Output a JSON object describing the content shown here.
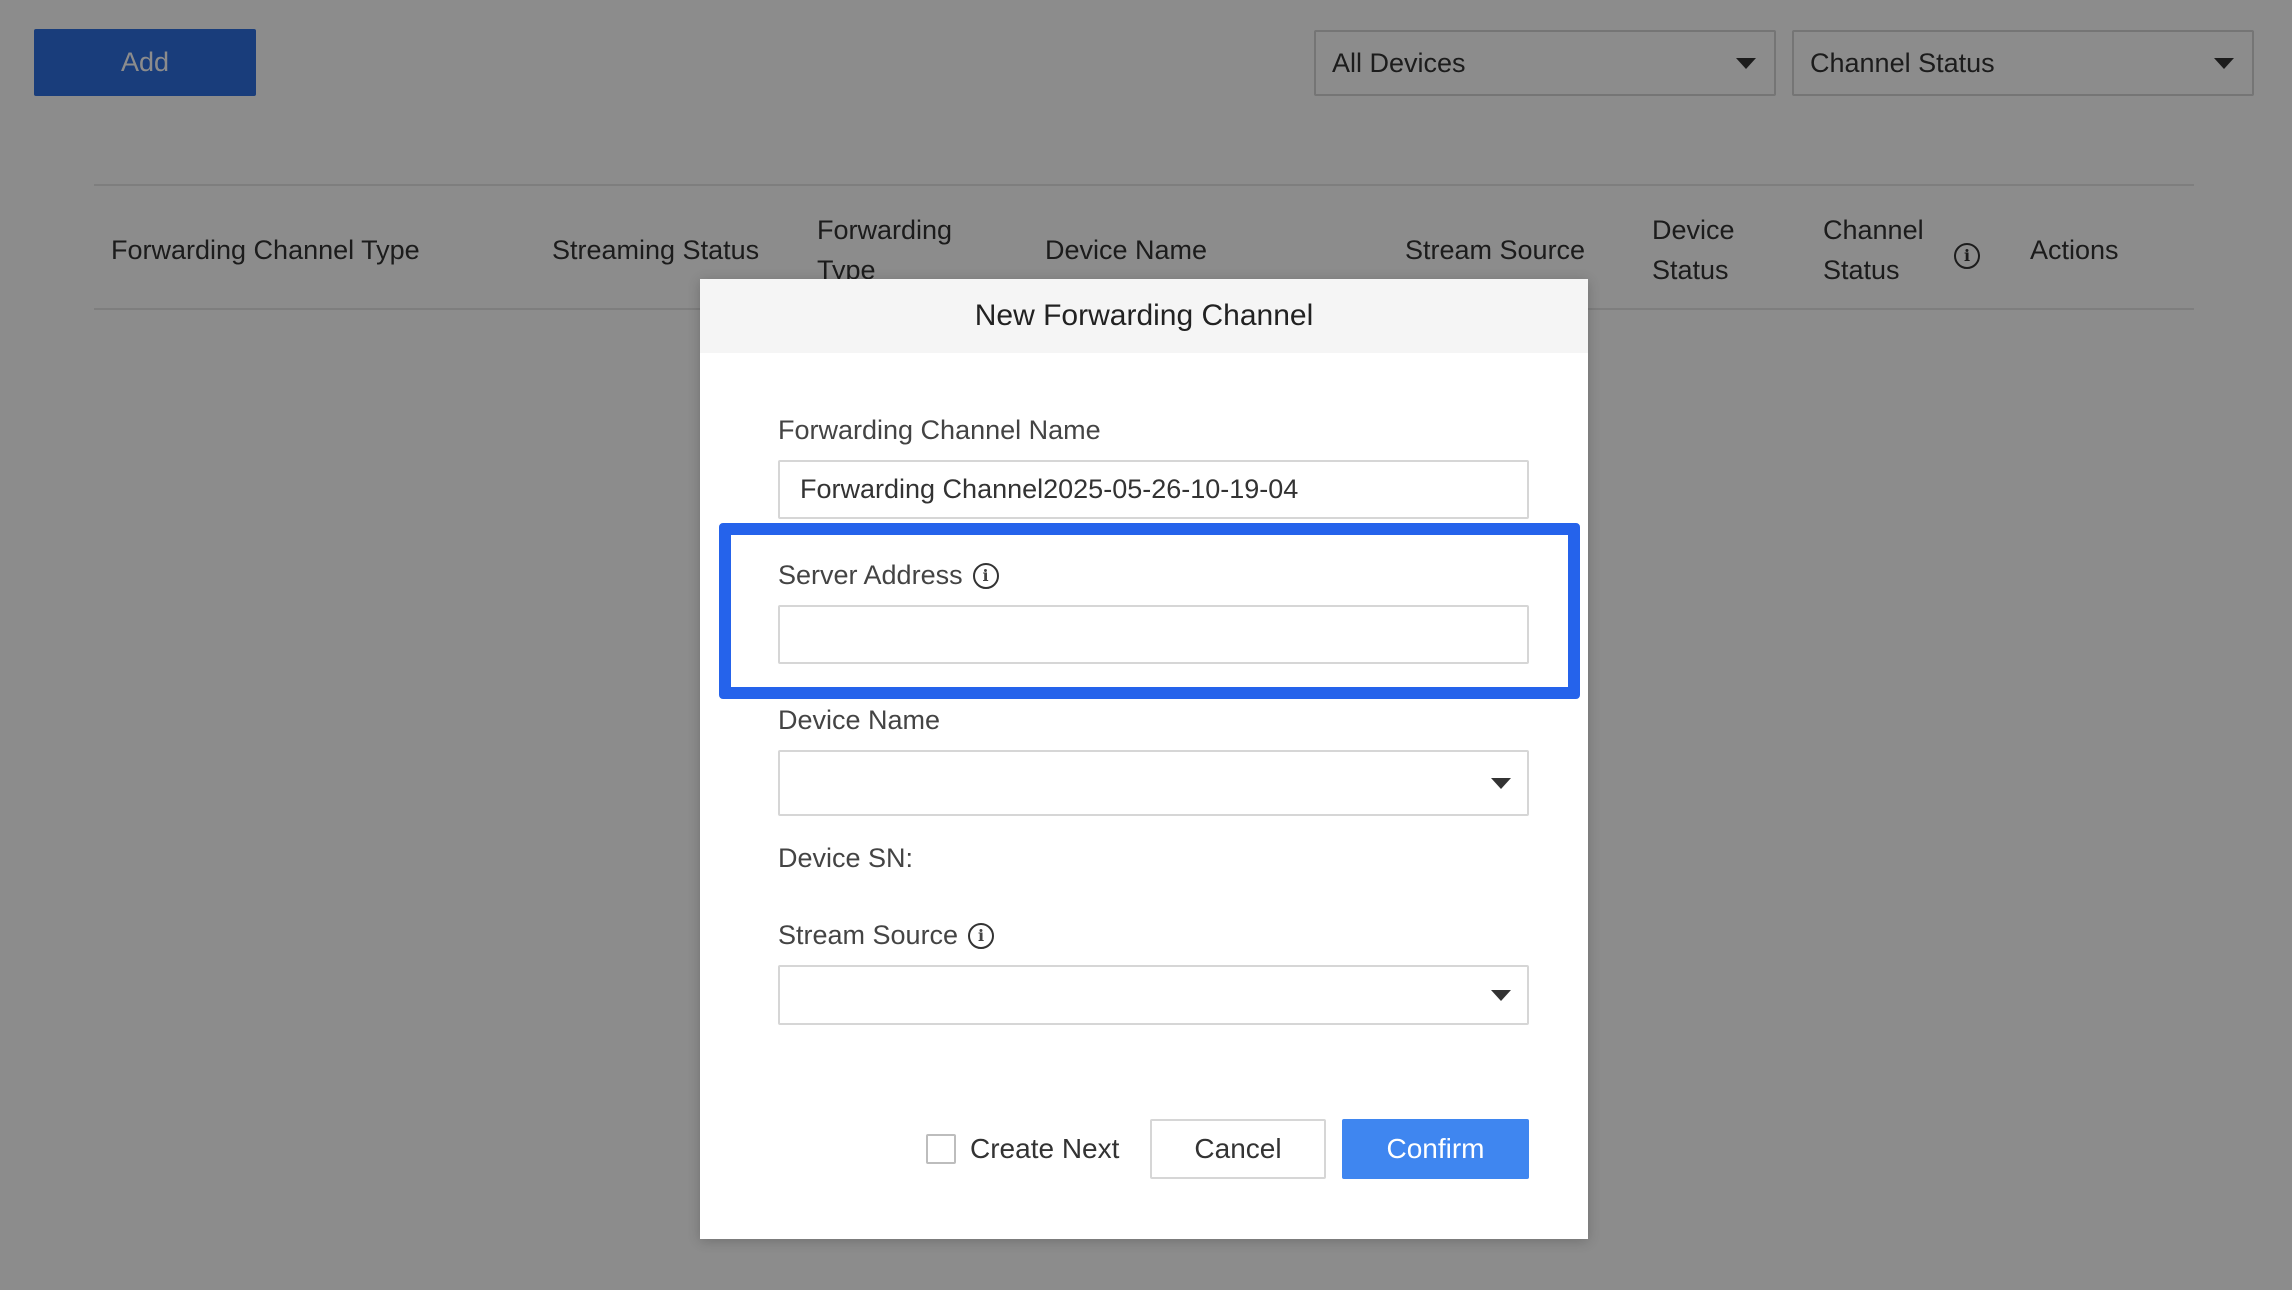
{
  "toolbar": {
    "add_label": "Add",
    "device_filter": "All Devices",
    "channel_status_filter": "Channel Status"
  },
  "table": {
    "headers": {
      "forwarding_channel_type": "Forwarding Channel Type",
      "streaming_status": "Streaming Status",
      "forwarding_type": "Forwarding Type",
      "device_name": "Device Name",
      "stream_source": "Stream Source",
      "device_status": "Device Status",
      "channel_status": "Channel Status",
      "actions": "Actions"
    }
  },
  "modal": {
    "title": "New Forwarding Channel",
    "channel_name_label": "Forwarding Channel Name",
    "channel_name_value": "Forwarding Channel2025-05-26-10-19-04",
    "server_address_label": "Server Address",
    "server_address_value": "",
    "device_name_label": "Device Name",
    "device_name_value": "",
    "device_sn_label": "Device SN:",
    "stream_source_label": "Stream Source",
    "stream_source_value": "",
    "create_next_label": "Create Next",
    "cancel_label": "Cancel",
    "confirm_label": "Confirm"
  },
  "colors": {
    "primary": "#3f86f0",
    "add_button": "#2f6fe0",
    "highlight": "#2563eb",
    "overlay": "rgba(0,0,0,0.45)"
  },
  "icons": {
    "info": "info-circle-icon",
    "dropdown": "caret-down-icon"
  }
}
